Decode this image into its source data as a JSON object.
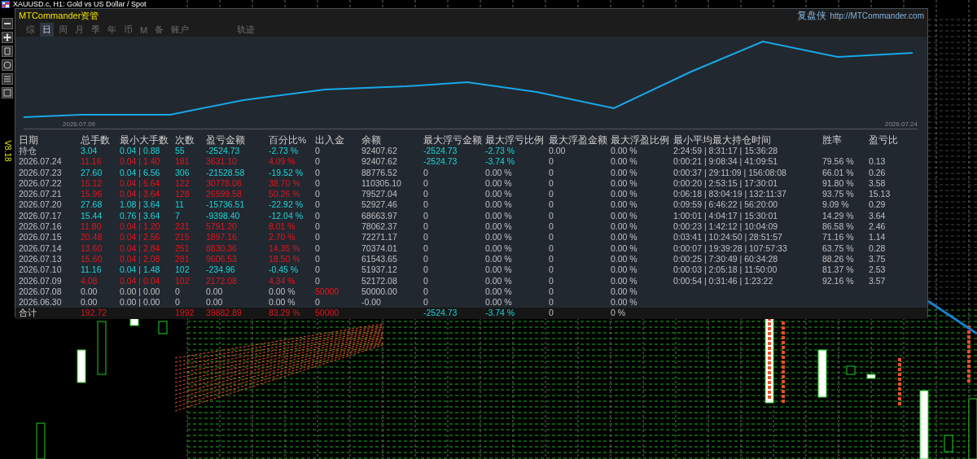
{
  "chart_window": {
    "title": "XAUUSD.c, H1:  Gold vs US Dollar / Spot",
    "version": "V8.18"
  },
  "panel": {
    "title": "MTCommander资管",
    "brand": "复盘侠",
    "link": "http://MTCommander.com"
  },
  "tabs": [
    {
      "label": "综",
      "selected": false
    },
    {
      "label": "日",
      "selected": true
    },
    {
      "label": "周",
      "selected": false
    },
    {
      "label": "月",
      "selected": false
    },
    {
      "label": "季",
      "selected": false
    },
    {
      "label": "年",
      "selected": false
    },
    {
      "label": "币",
      "selected": false
    },
    {
      "label": "M",
      "selected": false
    },
    {
      "label": "备",
      "selected": false
    },
    {
      "label": "账户",
      "selected": false
    },
    {
      "label": "轨迹",
      "selected": false
    }
  ],
  "equity_curve": {
    "start_label": "2026.07.09",
    "end_label": "2026.07.24"
  },
  "table": {
    "columns": [
      "日期",
      "总手数",
      "最小大手数",
      "次数",
      "盈亏金额",
      "百分比%",
      "出入金",
      "余额",
      "最大浮亏金额",
      "最大浮亏比例",
      "最大浮盈金额",
      "最大浮盈比例",
      "最小平均最大持仓时间",
      "胜率",
      "盈亏比"
    ],
    "rows": [
      {
        "traded": true,
        "profit": false,
        "deposit": false,
        "drawdown": true,
        "cells": [
          "持仓",
          "3.04",
          "0.04 | 0.88",
          "55",
          "-2524.73",
          "-2.73 %",
          "0",
          "92407.62",
          "-2524.73",
          "-2.73 %",
          "0.00",
          "0.00 %",
          "2:24:59 | 8:31:17 | 15:36:28",
          null,
          null
        ]
      },
      {
        "traded": true,
        "profit": true,
        "deposit": false,
        "drawdown": true,
        "cells": [
          "2026.07.24",
          "11.16",
          "0.04 | 1.40",
          "181",
          "3631.10",
          "4.09 %",
          "0",
          "92407.62",
          "-2524.73",
          "-3.74 %",
          "0",
          "0.00 %",
          "0:00:21 | 9:08:34 | 41:09:51",
          "79.56 %",
          "0.13"
        ]
      },
      {
        "traded": true,
        "profit": false,
        "deposit": false,
        "drawdown": false,
        "cells": [
          "2026.07.23",
          "27.60",
          "0.04 | 6.56",
          "306",
          "-21528.58",
          "-19.52 %",
          "0",
          "88776.52",
          "0",
          "0.00 %",
          "0",
          "0.00 %",
          "0:00:37 | 29:11:09 | 156:08:08",
          "66.01 %",
          "0.26"
        ]
      },
      {
        "traded": true,
        "profit": true,
        "deposit": false,
        "drawdown": false,
        "cells": [
          "2026.07.22",
          "15.12",
          "0.04 | 5.64",
          "122",
          "30778.06",
          "38.70 %",
          "0",
          "110305.10",
          "0",
          "0.00 %",
          "0",
          "0.00 %",
          "0:00:20 | 2:53:15 | 17:30:01",
          "91.80 %",
          "3.58"
        ]
      },
      {
        "traded": true,
        "profit": true,
        "deposit": false,
        "drawdown": false,
        "cells": [
          "2026.07.21",
          "15.96",
          "0.04 | 3.64",
          "128",
          "26599.58",
          "50.26 %",
          "0",
          "79527.04",
          "0",
          "0.00 %",
          "0",
          "0.00 %",
          "0:06:18 | 83:04:19 | 132:11:37",
          "93.75 %",
          "15.13"
        ]
      },
      {
        "traded": true,
        "profit": false,
        "deposit": false,
        "drawdown": false,
        "cells": [
          "2026.07.20",
          "27.68",
          "1.08 | 3.64",
          "11",
          "-15736.51",
          "-22.92 %",
          "0",
          "52927.46",
          "0",
          "0.00 %",
          "0",
          "0.00 %",
          "0:09:59 | 6:46:22 | 56:20:00",
          "9.09 %",
          "0.29"
        ]
      },
      {
        "traded": true,
        "profit": false,
        "deposit": false,
        "drawdown": false,
        "cells": [
          "2026.07.17",
          "15.44",
          "0.76 | 3.64",
          "7",
          "-9398.40",
          "-12.04 %",
          "0",
          "68663.97",
          "0",
          "0.00 %",
          "0",
          "0.00 %",
          "1:00:01 | 4:04:17 | 15:30:01",
          "14.29 %",
          "3.64"
        ]
      },
      {
        "traded": true,
        "profit": true,
        "deposit": false,
        "drawdown": false,
        "cells": [
          "2026.07.16",
          "11.80",
          "0.04 | 1.20",
          "231",
          "5791.20",
          "8.01 %",
          "0",
          "78062.37",
          "0",
          "0.00 %",
          "0",
          "0.00 %",
          "0:00:23 | 1:42:12 | 10:04:09",
          "86.58 %",
          "2.46"
        ]
      },
      {
        "traded": true,
        "profit": true,
        "deposit": false,
        "drawdown": false,
        "cells": [
          "2026.07.15",
          "20.48",
          "0.04 | 2.56",
          "215",
          "1897.16",
          "2.70 %",
          "0",
          "72271.17",
          "0",
          "0.00 %",
          "0",
          "0.00 %",
          "0:03:41 | 10:24:50 | 28:51:57",
          "71.16 %",
          "1.14"
        ]
      },
      {
        "traded": true,
        "profit": true,
        "deposit": false,
        "drawdown": false,
        "cells": [
          "2026.07.14",
          "13.60",
          "0.04 | 2.84",
          "251",
          "8830.36",
          "14.35 %",
          "0",
          "70374.01",
          "0",
          "0.00 %",
          "0",
          "0.00 %",
          "0:00:07 | 19:39:28 | 107:57:33",
          "63.75 %",
          "0.28"
        ]
      },
      {
        "traded": true,
        "profit": true,
        "deposit": false,
        "drawdown": false,
        "cells": [
          "2026.07.13",
          "15.60",
          "0.04 | 2.08",
          "281",
          "9606.53",
          "18.50 %",
          "0",
          "61543.65",
          "0",
          "0.00 %",
          "0",
          "0.00 %",
          "0:00:25 | 7:30:49 | 60:34:28",
          "88.26 %",
          "3.75"
        ]
      },
      {
        "traded": true,
        "profit": false,
        "deposit": false,
        "drawdown": false,
        "cells": [
          "2026.07.10",
          "11.16",
          "0.04 | 1.48",
          "102",
          "-234.96",
          "-0.45 %",
          "0",
          "51937.12",
          "0",
          "0.00 %",
          "0",
          "0.00 %",
          "0:00:03 | 2:05:18 | 11:50:00",
          "81.37 %",
          "2.53"
        ]
      },
      {
        "traded": true,
        "profit": true,
        "deposit": false,
        "drawdown": false,
        "cells": [
          "2026.07.09",
          "4.08",
          "0.04 | 0.04",
          "102",
          "2172.08",
          "4.34 %",
          "0",
          "52172.08",
          "0",
          "0.00 %",
          "0",
          "0.00 %",
          "0:00:54 | 0:31:46 | 1:23:22",
          "92.16 %",
          "3.57"
        ]
      },
      {
        "traded": false,
        "deposit": true,
        "drawdown": false,
        "cells": [
          "2026.07.08",
          "0.00",
          "0.00 | 0.00",
          "0",
          "0.00",
          "0.00 %",
          "50000",
          "50000.00",
          "0",
          "0.00 %",
          "0",
          "0.00 %",
          null,
          null,
          null
        ]
      },
      {
        "traded": false,
        "deposit": false,
        "drawdown": false,
        "cells": [
          "2026.06.30",
          "0.00",
          "0.00 | 0.00",
          "0",
          "0.00",
          "0.00 %",
          "0",
          "-0.00",
          "0",
          "0.00 %",
          "0",
          "0.00 %",
          null,
          null,
          null
        ]
      }
    ],
    "total": {
      "traded": true,
      "profit": true,
      "deposit": true,
      "drawdown": true,
      "cells": [
        "合计",
        "192.72",
        null,
        "1992",
        "39882.89",
        "83.29 %",
        "50000",
        null,
        "-2524.73",
        "-3.74 %",
        "0",
        "0 %",
        null,
        null,
        null
      ]
    }
  }
}
